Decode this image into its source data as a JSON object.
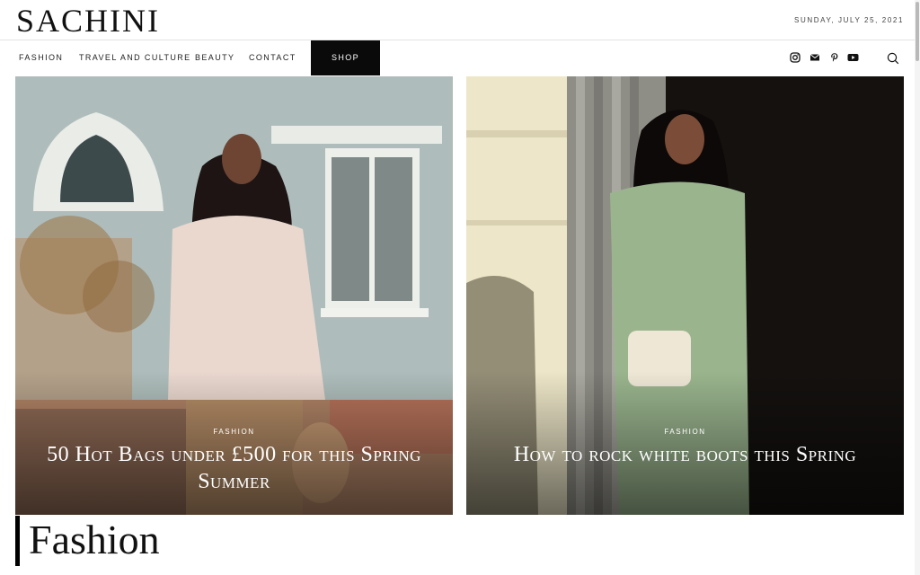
{
  "header": {
    "logo": "SACHINI",
    "date": "SUNDAY, JULY 25, 2021"
  },
  "nav": {
    "items": [
      "FASHION",
      "TRAVEL AND CULTURE",
      "BEAUTY",
      "CONTACT"
    ],
    "shop_label": "SHOP",
    "social_icons": [
      "instagram-icon",
      "email-icon",
      "pinterest-icon",
      "youtube-icon"
    ],
    "search_icon": "search-icon"
  },
  "featured": [
    {
      "category": "FASHION",
      "title": "50 Hot Bags under £500 for this Spring Summer"
    },
    {
      "category": "FASHION",
      "title": "How to rock white boots this Spring"
    }
  ],
  "section": {
    "title": "Fashion"
  },
  "colors": {
    "accent": "#0a0a0a",
    "text": "#111111",
    "overlay_text": "#ffffff"
  }
}
